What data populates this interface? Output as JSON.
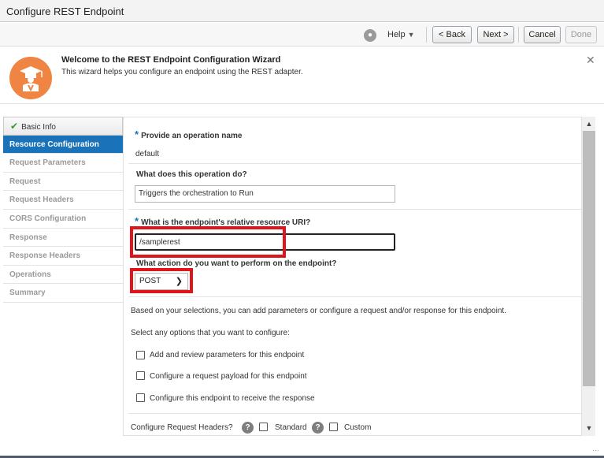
{
  "window": {
    "title": "Configure REST Endpoint"
  },
  "toolbar": {
    "help_label": "Help",
    "back_label": "< Back",
    "next_label": "Next >",
    "cancel_label": "Cancel",
    "done_label": "Done"
  },
  "welcome": {
    "title": "Welcome to the REST Endpoint Configuration Wizard",
    "description": "This wizard helps you configure an endpoint using the REST adapter."
  },
  "steps": [
    {
      "label": "Basic Info",
      "state": "completed"
    },
    {
      "label": "Resource Configuration",
      "state": "active"
    },
    {
      "label": "Request Parameters",
      "state": "pending"
    },
    {
      "label": "Request",
      "state": "pending"
    },
    {
      "label": "Request Headers",
      "state": "pending"
    },
    {
      "label": "CORS Configuration",
      "state": "pending"
    },
    {
      "label": "Response",
      "state": "pending"
    },
    {
      "label": "Response Headers",
      "state": "pending"
    },
    {
      "label": "Operations",
      "state": "pending"
    },
    {
      "label": "Summary",
      "state": "pending"
    }
  ],
  "form": {
    "operation_name_label": "Provide an operation name",
    "operation_name_value": "default",
    "operation_desc_label": "What does this operation do?",
    "operation_desc_value": "Triggers the orchestration to Run",
    "uri_label": "What is the endpoint's relative resource URI?",
    "uri_value": "/samplerest",
    "action_label": "What action do you want to perform on the endpoint?",
    "action_value": "POST",
    "info_text": "Based on your selections, you can add parameters or configure a request and/or response for this endpoint.",
    "options_label": "Select any options that you want to configure:",
    "option_params": "Add and review parameters for this endpoint",
    "option_request": "Configure a request payload for this endpoint",
    "option_response": "Configure this endpoint to receive the response",
    "headers_label": "Configure Request Headers?",
    "headers_standard": "Standard",
    "headers_custom": "Custom"
  },
  "colors": {
    "accent": "#1a73b8",
    "highlight": "#e0151b",
    "welcome_icon": "#f08442"
  }
}
